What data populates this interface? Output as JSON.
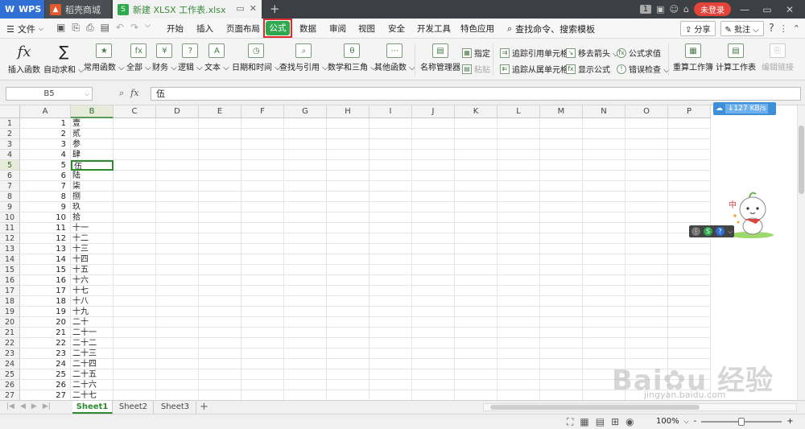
{
  "titlebar": {
    "app_tab": "WPS",
    "mall_tab": "稻壳商城",
    "doc_tab": "新建 XLSX 工作表.xlsx",
    "add_tab": "+",
    "count": "1",
    "login": "未登录"
  },
  "menu": {
    "file": "文件",
    "items": [
      "开始",
      "插入",
      "页面布局",
      "公式",
      "数据",
      "审阅",
      "视图",
      "安全",
      "开发工具",
      "特色应用"
    ],
    "active": "公式",
    "search": "查找命令、搜索模板",
    "share": "分享",
    "comment": "批注",
    "help": "?"
  },
  "ribbon": {
    "insert_fn": "插入函数",
    "autosum": "自动求和",
    "common_fn": "常用函数",
    "all": "全部",
    "finance": "财务",
    "logic": "逻辑",
    "text": "文本",
    "datetime": "日期和时间",
    "lookup": "查找与引用",
    "math": "数学和三角",
    "other_fn": "其他函数",
    "name_mgr": "名称管理器",
    "specify": "指定",
    "paste": "粘贴",
    "trace_prec": "追踪引用单元格",
    "trace_dep": "追踪从属单元格",
    "remove_arrows": "移去箭头",
    "show_formula": "显示公式",
    "eval_formula": "公式求值",
    "error_check": "错误检查",
    "recalc_book": "重算工作簿",
    "calc_sheet": "计算工作表",
    "edit_links": "编辑链接"
  },
  "formula": {
    "cell_ref": "B5",
    "fx": "fx",
    "value": "伍"
  },
  "columns": [
    "A",
    "B",
    "C",
    "D",
    "E",
    "F",
    "G",
    "H",
    "I",
    "J",
    "K",
    "L",
    "M",
    "N",
    "O",
    "P"
  ],
  "rows": [
    {
      "n": "1",
      "a": "1",
      "b": "壹"
    },
    {
      "n": "2",
      "a": "2",
      "b": "贰"
    },
    {
      "n": "3",
      "a": "3",
      "b": "参"
    },
    {
      "n": "4",
      "a": "4",
      "b": "肆"
    },
    {
      "n": "5",
      "a": "5",
      "b": "伍"
    },
    {
      "n": "6",
      "a": "6",
      "b": "陆"
    },
    {
      "n": "7",
      "a": "7",
      "b": "柒"
    },
    {
      "n": "8",
      "a": "8",
      "b": "捌"
    },
    {
      "n": "9",
      "a": "9",
      "b": "玖"
    },
    {
      "n": "10",
      "a": "10",
      "b": "拾"
    },
    {
      "n": "11",
      "a": "11",
      "b": "十一"
    },
    {
      "n": "12",
      "a": "12",
      "b": "十二"
    },
    {
      "n": "13",
      "a": "13",
      "b": "十三"
    },
    {
      "n": "14",
      "a": "14",
      "b": "十四"
    },
    {
      "n": "15",
      "a": "15",
      "b": "十五"
    },
    {
      "n": "16",
      "a": "16",
      "b": "十六"
    },
    {
      "n": "17",
      "a": "17",
      "b": "十七"
    },
    {
      "n": "18",
      "a": "18",
      "b": "十八"
    },
    {
      "n": "19",
      "a": "19",
      "b": "十九"
    },
    {
      "n": "20",
      "a": "20",
      "b": "二十"
    },
    {
      "n": "21",
      "a": "21",
      "b": "二十一"
    },
    {
      "n": "22",
      "a": "22",
      "b": "二十二"
    },
    {
      "n": "23",
      "a": "23",
      "b": "二十三"
    },
    {
      "n": "24",
      "a": "24",
      "b": "二十四"
    },
    {
      "n": "25",
      "a": "25",
      "b": "二十五"
    },
    {
      "n": "26",
      "a": "26",
      "b": "二十六"
    },
    {
      "n": "27",
      "a": "27",
      "b": "二十七"
    }
  ],
  "selection": {
    "row": 5,
    "col": "B"
  },
  "net_widget": {
    "speed": "127 KB/s"
  },
  "sheets": [
    "Sheet1",
    "Sheet2",
    "Sheet3"
  ],
  "active_sheet": "Sheet1",
  "status": {
    "zoom": "100%",
    "minus": "-",
    "plus": "+"
  },
  "watermark": {
    "text": "Bai 经验",
    "url": "jingyan.baidu.com"
  },
  "colors": {
    "accent": "#2fa84f",
    "highlight": "#e22a2a",
    "wps_blue": "#2f6fd6"
  }
}
